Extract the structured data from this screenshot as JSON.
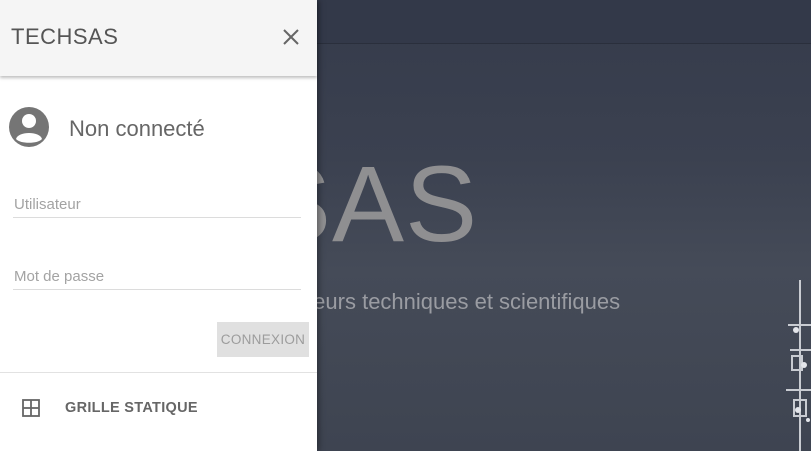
{
  "drawer": {
    "title": "TECHSAS",
    "user_status": "Non connecté",
    "username_placeholder": "Utilisateur",
    "password_placeholder": "Mot de passe",
    "connect_label": "CONNEXION",
    "nav_items": [
      {
        "label": "GRILLE STATIQUE",
        "icon": "grid-icon"
      }
    ]
  },
  "hero": {
    "title": "HSAS",
    "subtitle": "des capteurs techniques et scientifiques"
  },
  "icons": {
    "close": "close-icon",
    "avatar": "account-circle-icon",
    "grid": "grid-icon"
  },
  "colors": {
    "drawer_bg": "#ffffff",
    "header_bg": "#f5f5f5",
    "hero_bg": "#3d4352",
    "text_gray": "#666666"
  }
}
